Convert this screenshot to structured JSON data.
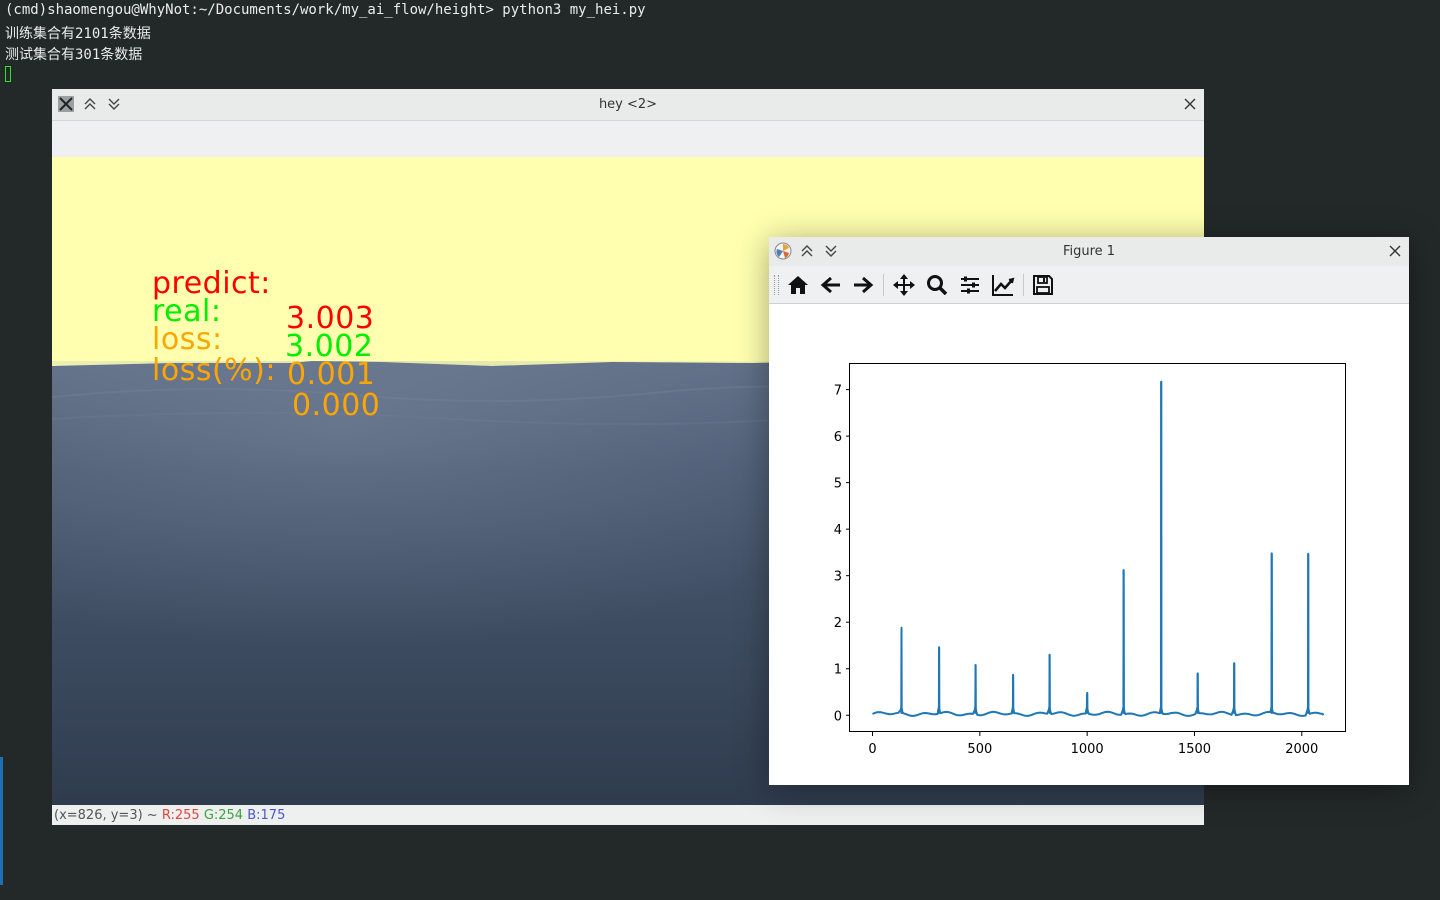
{
  "terminal": {
    "lines": [
      "(cmd)shaomengou@WhyNot:~/Documents/work/my_ai_flow/height> python3 my_hei.py",
      "训练集合有2101条数据",
      "测试集合有301条数据"
    ]
  },
  "hey_window": {
    "title": "hey <2>",
    "overlay": {
      "predict_label": "predict:",
      "predict_value": "3.003",
      "real_label": "real:",
      "real_value": "3.002",
      "loss_label": "loss:",
      "loss_value": "0.001",
      "loss_pct_label": "loss(%):",
      "loss_pct_value": "0.000",
      "colors": {
        "predict": "#ff0000",
        "real": "#00ee00",
        "loss": "#ffa500"
      }
    },
    "status": {
      "coords": "(x=826, y=3) ~",
      "r": "R:255",
      "g": "G:254",
      "b": "B:175"
    }
  },
  "figure_window": {
    "title": "Figure 1",
    "toolbar": [
      "home-icon",
      "back-arrow-icon",
      "forward-arrow-icon",
      "pan-icon",
      "zoom-icon",
      "subplots-config-icon",
      "edit-axis-icon",
      "save-icon"
    ]
  },
  "chart_data": {
    "type": "line",
    "title": "",
    "xlabel": "",
    "ylabel": "",
    "xlim": [
      -105,
      2206
    ],
    "ylim": [
      -0.36,
      7.55
    ],
    "xticks": [
      "0",
      "500",
      "1000",
      "1500",
      "2000"
    ],
    "yticks": [
      "0",
      "1",
      "2",
      "3",
      "4",
      "5",
      "6",
      "7"
    ],
    "grid": false,
    "line_color": "#1f77b4",
    "baseline": 0.03,
    "spikes": [
      {
        "x": 135,
        "y": 1.88
      },
      {
        "x": 310,
        "y": 1.46
      },
      {
        "x": 480,
        "y": 1.08
      },
      {
        "x": 655,
        "y": 0.87
      },
      {
        "x": 825,
        "y": 1.3
      },
      {
        "x": 1000,
        "y": 0.48
      },
      {
        "x": 1170,
        "y": 3.12
      },
      {
        "x": 1345,
        "y": 7.17
      },
      {
        "x": 1515,
        "y": 0.9
      },
      {
        "x": 1685,
        "y": 1.12
      },
      {
        "x": 1860,
        "y": 3.48
      },
      {
        "x": 2030,
        "y": 3.47
      }
    ],
    "x_end": 2100
  }
}
